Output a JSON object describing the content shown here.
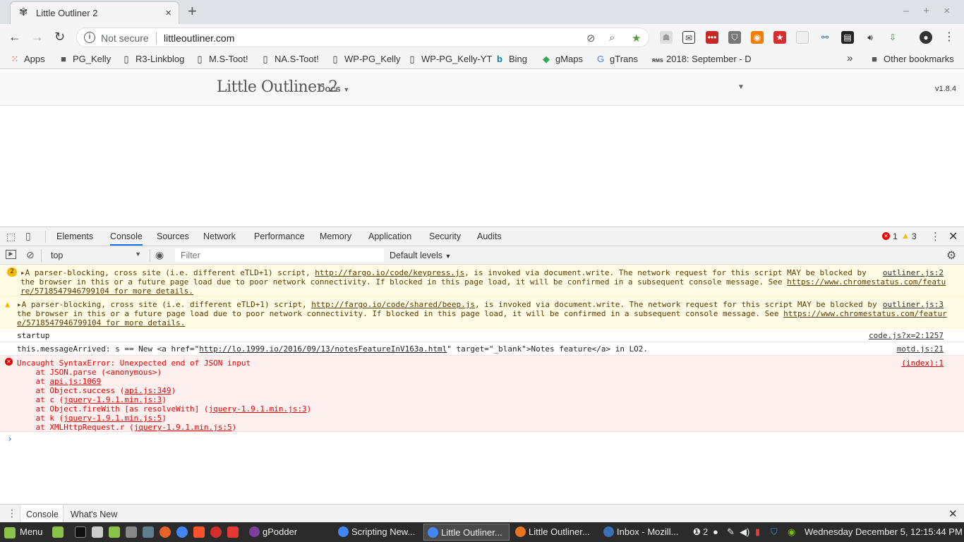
{
  "browser": {
    "tab_title": "Little Outliner 2",
    "tab_close": "×",
    "new_tab": "+",
    "window_controls": "– + ×",
    "security_label": "Not secure",
    "url": "littleoutliner.com"
  },
  "bookmarks": [
    {
      "label": "Apps",
      "icon": "apps-grid-icon"
    },
    {
      "label": "PG_Kelly",
      "icon": "folder-icon"
    },
    {
      "label": "R3-Linkblog",
      "icon": "page-icon"
    },
    {
      "label": "M.S-Toot!",
      "icon": "page-icon"
    },
    {
      "label": "NA.S-Toot!",
      "icon": "page-icon"
    },
    {
      "label": "WP-PG_Kelly",
      "icon": "page-icon"
    },
    {
      "label": "WP-PG_Kelly-YT",
      "icon": "page-icon"
    },
    {
      "label": "Bing",
      "icon": "bing-icon"
    },
    {
      "label": "gMaps",
      "icon": "maps-icon"
    },
    {
      "label": "gTrans",
      "icon": "translate-icon"
    },
    {
      "label": "2018: September - D",
      "icon": "rms-icon"
    }
  ],
  "bookmarks_overflow": "»",
  "other_bookmarks": "Other bookmarks",
  "site": {
    "brand": "Little Outliner 2",
    "docs_menu": "Docs",
    "version": "v1.8.4"
  },
  "devtools": {
    "tabs": [
      "Elements",
      "Console",
      "Sources",
      "Network",
      "Performance",
      "Memory",
      "Application",
      "Security",
      "Audits"
    ],
    "active_tab": "Console",
    "error_count": "1",
    "warning_count": "3",
    "context": "top",
    "filter_placeholder": "Filter",
    "levels": "Default levels",
    "drawer_tabs": [
      "Console",
      "What's New"
    ]
  },
  "console_messages": [
    {
      "type": "warning",
      "badge": "2",
      "lines": [
        "A parser-blocking, cross site (i.e. different eTLD+1) script, ",
        "the browser in this or a future page load due to poor network connectivity. If blocked in this page load, it will be confirmed in a subsequent console message. See ",
        "re/5718547946799104 for more details."
      ],
      "link1": "http://fargo.io/code/keypress.js",
      "line1_tail": ", is invoked via document.write. The network request for this script MAY be blocked by",
      "link2": "https://www.chromestatus.com/featu",
      "source": "outliner.js:2"
    },
    {
      "type": "warning",
      "lines": [
        "A parser-blocking, cross site (i.e. different eTLD+1) script, ",
        "the browser in this or a future page load due to poor network connectivity. If blocked in this page load, it will be confirmed in a subsequent console message. See ",
        "e/5718547946799104 for more details."
      ],
      "link1": "http://fargo.io/code/shared/beep.js",
      "line1_tail": ", is invoked via document.write. The network request for this script MAY be blocked by",
      "link2": "https://www.chromestatus.com/featur",
      "source": "outliner.js:3"
    },
    {
      "type": "log",
      "text": "startup",
      "source": "code.js?x=2:1257"
    },
    {
      "type": "log",
      "text_pre": "this.messageArrived: s == New <a href=\"",
      "link": "http://lo.1999.io/2016/09/13/notesFeatureInV163a.html",
      "text_post": "\" target=\"_blank\">Notes feature</a> in LO2.",
      "source": "motd.js:21"
    },
    {
      "type": "error",
      "text": "Uncaught SyntaxError: Unexpected end of JSON input",
      "source": "(index):1",
      "stack": [
        {
          "pre": "    at JSON.parse (<anonymous>)",
          "link": "",
          "post": ""
        },
        {
          "pre": "    at ",
          "link": "api.js:1069",
          "post": ""
        },
        {
          "pre": "    at Object.success (",
          "link": "api.js:349",
          "post": ")"
        },
        {
          "pre": "    at c (",
          "link": "jquery-1.9.1.min.js:3",
          "post": ")"
        },
        {
          "pre": "    at Object.fireWith [as resolveWith] (",
          "link": "jquery-1.9.1.min.js:3",
          "post": ")"
        },
        {
          "pre": "    at k (",
          "link": "jquery-1.9.1.min.js:5",
          "post": ")"
        },
        {
          "pre": "    at XMLHttpRequest.r (",
          "link": "jquery-1.9.1.min.js:5",
          "post": ")"
        }
      ]
    }
  ],
  "prompt": "›",
  "taskbar": {
    "menu_label": "Menu",
    "windows": [
      {
        "label": "gPodder",
        "color": "#7b3fa0"
      },
      {
        "label": "Scripting New...",
        "color": "#4285f4"
      },
      {
        "label": "Little Outliner...",
        "color": "#4285f4",
        "active": true
      },
      {
        "label": "Little Outliner...",
        "color": "#e87722"
      },
      {
        "label": "Inbox - Mozill...",
        "color": "#3b6fb6"
      }
    ],
    "tray_count": "2",
    "clock": "Wednesday December  5, 12:15:44 PM"
  },
  "colors": {
    "accent": "#1a73e8",
    "error": "#e00000",
    "warning": "#f3b800"
  }
}
